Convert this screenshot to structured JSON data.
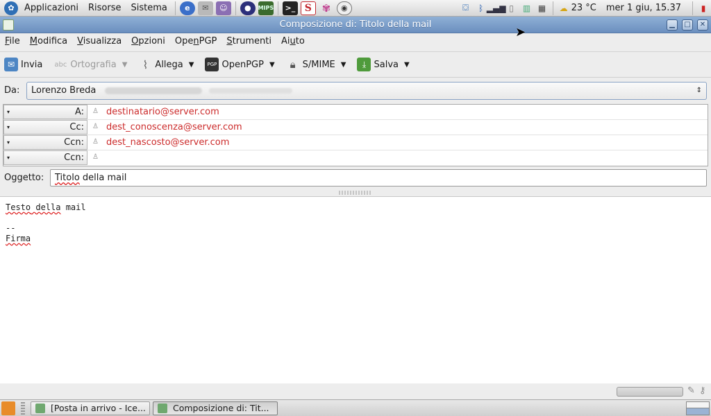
{
  "panel": {
    "menus": [
      "Applicazioni",
      "Risorse",
      "Sistema"
    ],
    "launchers": [
      "ie-icon",
      "mail-icon",
      "pidgin-icon",
      "eclipse-icon",
      "mips-icon",
      "terminal-icon",
      "s-icon",
      "flower-icon",
      "webcam-icon"
    ],
    "mips_label": "MIPS",
    "s_label": "S",
    "weather": "23 °C",
    "clock": "mer  1 giu, 15.37"
  },
  "window": {
    "title": "Composizione di: Titolo della mail"
  },
  "menubar": {
    "items": [
      {
        "accel": "F",
        "rest": "ile"
      },
      {
        "accel": "M",
        "rest": "odifica"
      },
      {
        "accel": "V",
        "rest": "isualizza"
      },
      {
        "accel": "O",
        "rest": "pzioni"
      },
      {
        "pre": "Ope",
        "accel": "n",
        "rest": "PGP"
      },
      {
        "accel": "S",
        "rest": "trumenti"
      },
      {
        "pre": "Ai",
        "accel": "u",
        "rest": "to"
      }
    ]
  },
  "toolbar": {
    "send": "Invia",
    "spelling": "Ortografia",
    "attach": "Allega",
    "openpgp": "OpenPGP",
    "smime": "S/MIME",
    "save": "Salva",
    "pgp_badge": "PGP"
  },
  "from": {
    "label": "Da:",
    "name": "Lorenzo Breda"
  },
  "recipients": [
    {
      "type": "A:",
      "address": "destinatario@server.com"
    },
    {
      "type": "Cc:",
      "address": "dest_conoscenza@server.com"
    },
    {
      "type": "Ccn:",
      "address": "dest_nascosto@server.com"
    },
    {
      "type": "Ccn:",
      "address": ""
    }
  ],
  "subject": {
    "label": "Oggetto:",
    "word1": "Titolo",
    "rest": " della mail"
  },
  "body": {
    "line1a": "Testo",
    "line1b": " della",
    "line1c": " mail",
    "sig_sep": "--",
    "signature": "Firma"
  },
  "taskbar": {
    "tasks": [
      "[Posta in arrivo - Ice...",
      "Composizione di: Tit..."
    ]
  },
  "colors": {
    "titlebar": "#7a9cc8",
    "recipient_text": "#cc2b2b"
  }
}
